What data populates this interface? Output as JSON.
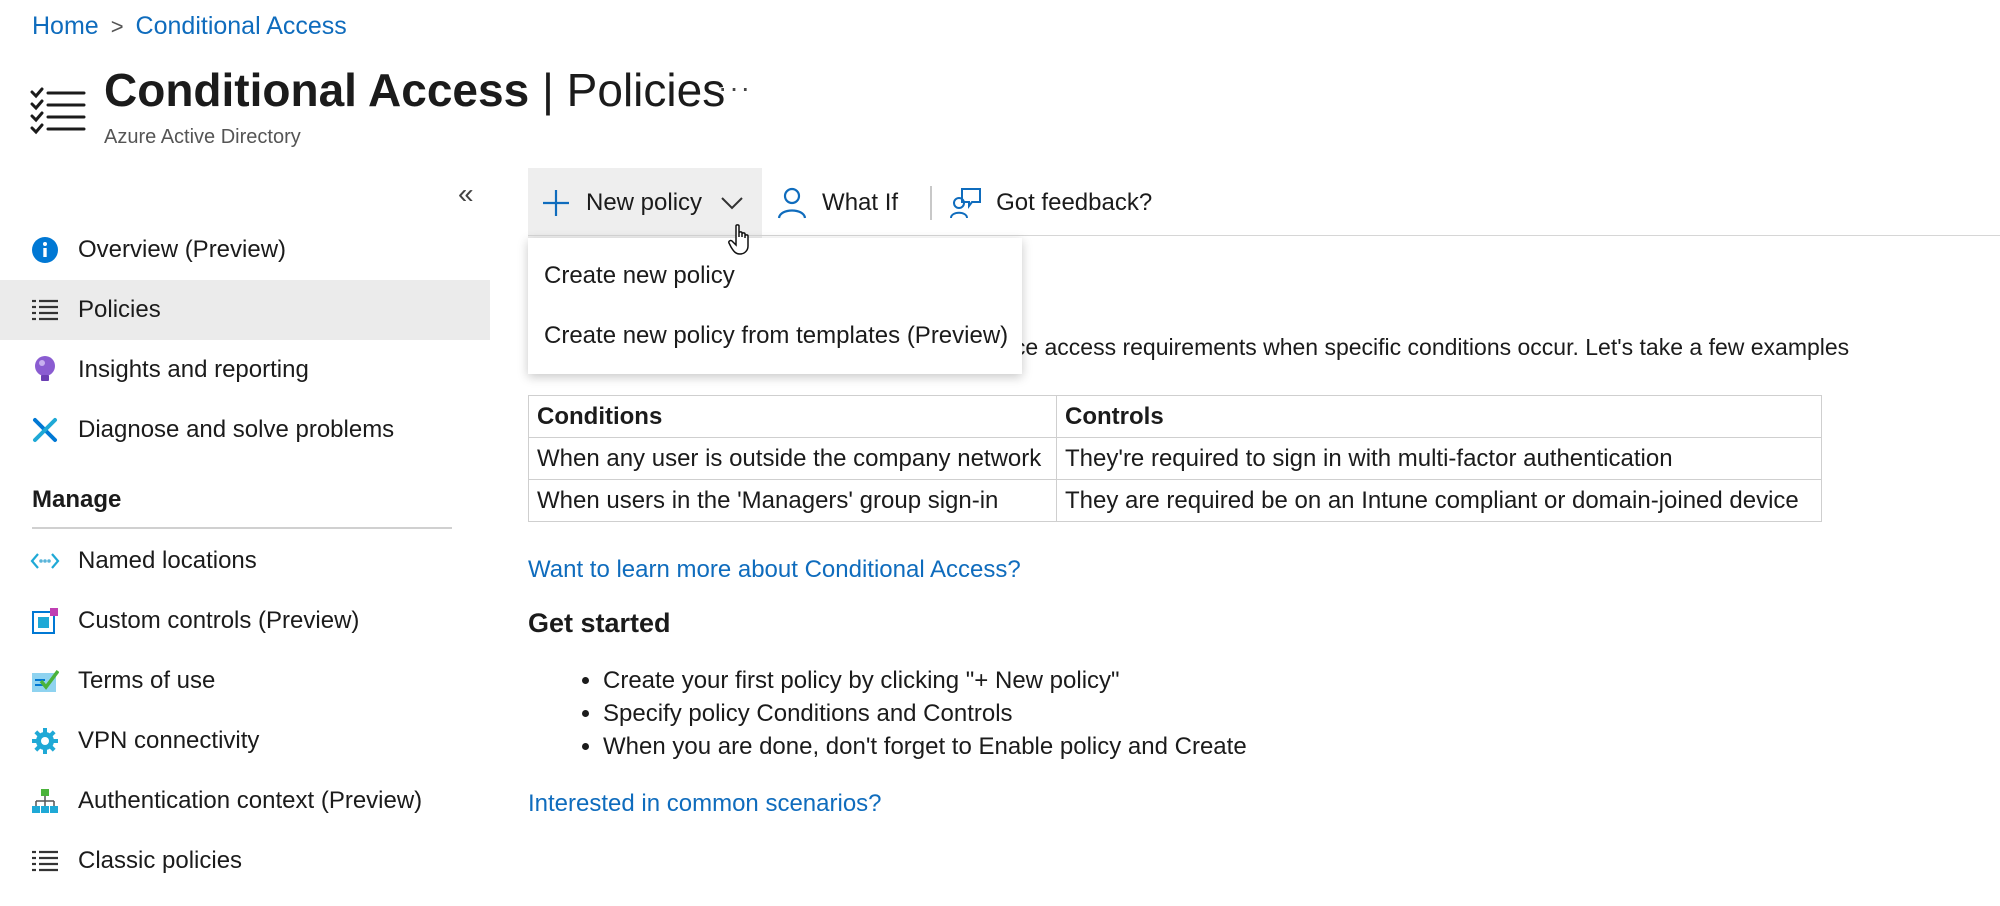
{
  "breadcrumb": {
    "home": "Home",
    "separator": ">",
    "current": "Conditional Access"
  },
  "header": {
    "title_bold": "Conditional Access",
    "title_rest": " | Policies",
    "subtitle": "Azure Active Directory",
    "more": "···",
    "icon": "checklist-icon"
  },
  "sidebar": {
    "collapse_label": "«",
    "items": [
      {
        "label": "Overview (Preview)",
        "icon": "info-icon"
      },
      {
        "label": "Policies",
        "icon": "list-icon"
      },
      {
        "label": "Insights and reporting",
        "icon": "lightbulb-icon"
      },
      {
        "label": "Diagnose and solve problems",
        "icon": "wrench-icon"
      }
    ],
    "manage_label": "Manage",
    "manage_items": [
      {
        "label": "Named locations",
        "icon": "network-icon"
      },
      {
        "label": "Custom controls (Preview)",
        "icon": "custom-controls-icon"
      },
      {
        "label": "Terms of use",
        "icon": "checkmark-doc-icon"
      },
      {
        "label": "VPN connectivity",
        "icon": "gear-icon"
      },
      {
        "label": "Authentication context (Preview)",
        "icon": "hierarchy-icon"
      },
      {
        "label": "Classic policies",
        "icon": "list-icon"
      }
    ],
    "active_index": 1
  },
  "toolbar": {
    "new_policy": "New policy",
    "what_if": "What If",
    "feedback": "Got feedback?"
  },
  "dropdown": {
    "items": [
      "Create new policy",
      "Create new policy from templates (Preview)"
    ]
  },
  "main": {
    "intro": "Conditional Access gives you the ability to enforce access requirements when specific conditions occur. Let's take a few examples",
    "table": {
      "headers": [
        "Conditions",
        "Controls"
      ],
      "rows": [
        [
          "When any user is outside the company network",
          "They're required to sign in with multi-factor authentication"
        ],
        [
          "When users in the 'Managers' group sign-in",
          "They are required be on an Intune compliant or domain-joined device"
        ]
      ]
    },
    "learn_more": "Want to learn more about Conditional Access?",
    "get_started": "Get started",
    "steps": [
      "Create your first policy by clicking \"+ New policy\"",
      "Specify policy Conditions and Controls",
      "When you are done, don't forget to Enable policy and Create"
    ],
    "scenarios": "Interested in common scenarios?"
  },
  "colors": {
    "link": "#0f6cbd",
    "active_bg": "#ebebeb",
    "accent": "#0078d4"
  }
}
